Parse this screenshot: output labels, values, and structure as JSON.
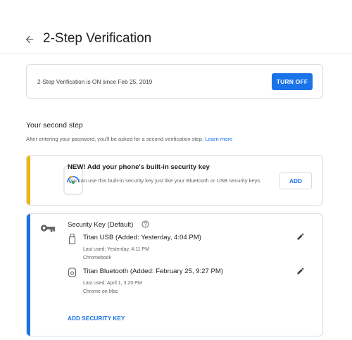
{
  "header": {
    "title": "2-Step Verification",
    "back_icon": "arrow-back-icon"
  },
  "status": {
    "text": "2-Step Verification is ON since Feb 25, 2019",
    "button_label": "TURN OFF"
  },
  "second_step": {
    "title": "Your second step",
    "description": "After entering your password, you'll be asked for a second verification step.",
    "learn_more": "Learn more"
  },
  "builtin_key": {
    "title": "NEW! Add your phone's built-in security key",
    "description": "You can use this built-in security key just like your Bluetooth or USB security keys",
    "button_label": "ADD",
    "icon": "phone-security-key-icon"
  },
  "security_keys": {
    "title": "Security Key (Default)",
    "keys": [
      {
        "name": "Titan USB (Added: Yesterday, 4:04 PM)",
        "last_used": "Last used: Yesterday, 4:11 PM",
        "device": "Chromebook",
        "icon": "usb-icon"
      },
      {
        "name": "Titan Bluetooth (Added: February 25, 9:27 PM)",
        "last_used": "Last used: April 1, 3:20 PM",
        "device": "Chrome on Mac",
        "icon": "bluetooth-key-icon"
      }
    ],
    "add_label": "ADD SECURITY KEY"
  },
  "colors": {
    "accent_blue": "#1a73e8",
    "accent_yellow": "#f4b400",
    "text_secondary": "#5f6368"
  }
}
